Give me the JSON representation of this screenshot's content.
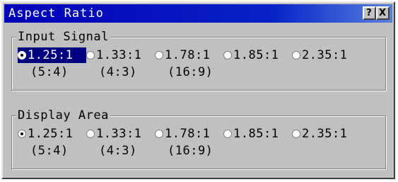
{
  "window": {
    "title": "Aspect Ratio",
    "help_label": "?",
    "close_label": "X"
  },
  "input_signal": {
    "label": "Input Signal",
    "selected_index": 0,
    "options": [
      {
        "label": "1.25:1",
        "sub": "(5:4)"
      },
      {
        "label": "1.33:1",
        "sub": "(4:3)"
      },
      {
        "label": "1.78:1",
        "sub": "(16:9)"
      },
      {
        "label": "1.85:1",
        "sub": ""
      },
      {
        "label": "2.35:1",
        "sub": ""
      }
    ]
  },
  "display_area": {
    "label": "Display Area",
    "selected_index": 0,
    "options": [
      {
        "label": "1.25:1",
        "sub": "(5:4)"
      },
      {
        "label": "1.33:1",
        "sub": "(4:3)"
      },
      {
        "label": "1.78:1",
        "sub": "(16:9)"
      },
      {
        "label": "1.85:1",
        "sub": ""
      },
      {
        "label": "2.35:1",
        "sub": ""
      }
    ]
  }
}
